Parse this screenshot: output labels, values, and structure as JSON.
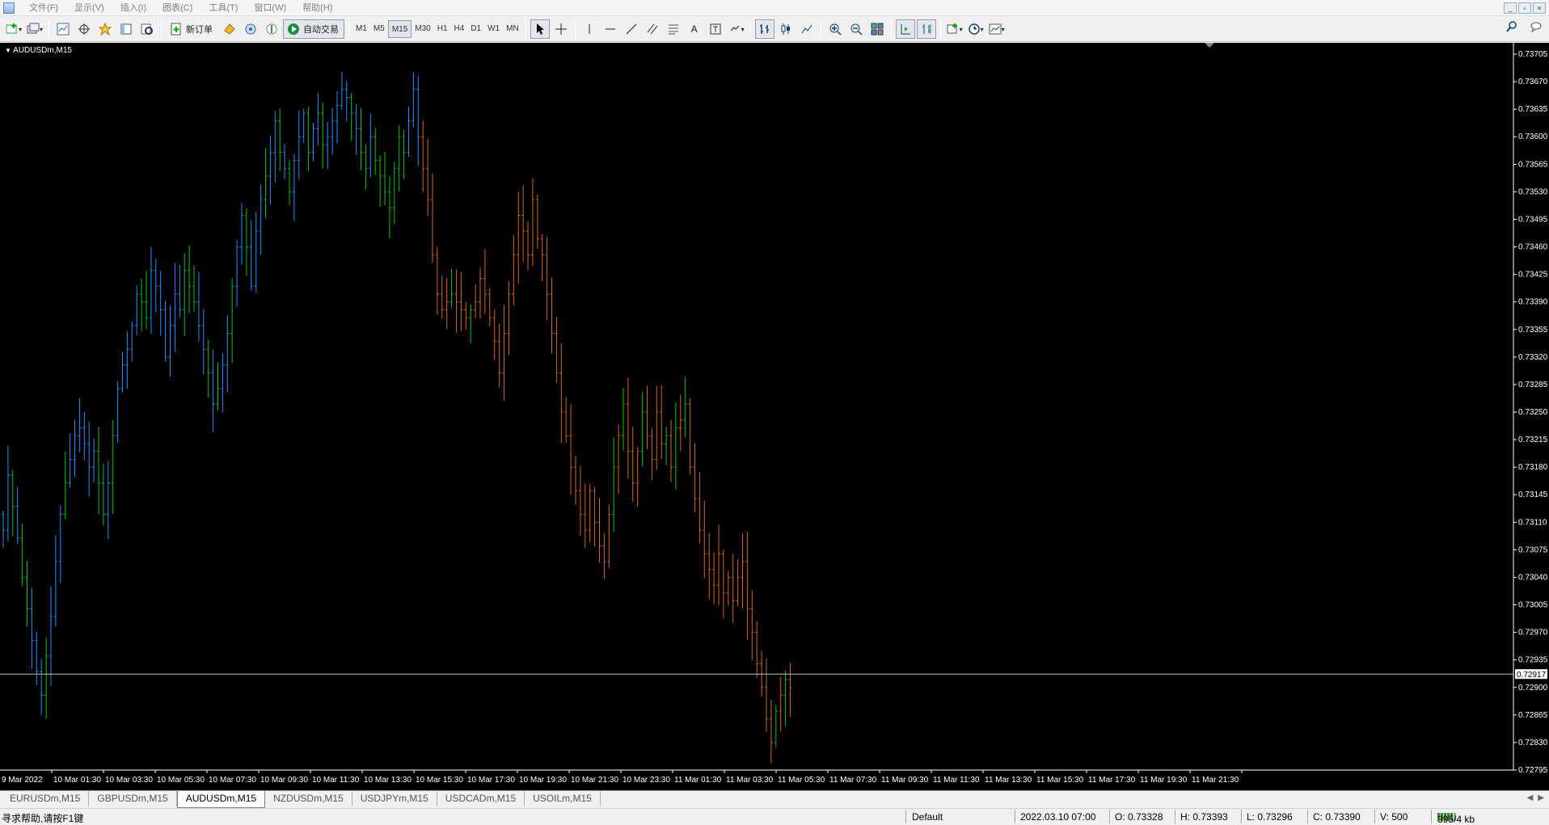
{
  "menu": [
    "文件(F)",
    "显示(V)",
    "插入(I)",
    "图表(C)",
    "工具(T)",
    "窗口(W)",
    "帮助(H)"
  ],
  "toolbar": {
    "new_order": "新订单",
    "auto_trading": "自动交易",
    "timeframes": [
      "M1",
      "M5",
      "M15",
      "M30",
      "H1",
      "H4",
      "D1",
      "W1",
      "MN"
    ],
    "active_timeframe": "M15"
  },
  "chart": {
    "symbol_label": "AUDUSDm,M15",
    "current_price_label": "0.72917",
    "colors": {
      "background": "#000000",
      "up": "#1E90FF",
      "down": "#D2691E",
      "neutral_up": "#00C800",
      "axis": "#ffffff",
      "price_line": "#c0c0c0"
    }
  },
  "chart_data": {
    "type": "ohlc",
    "title": "AUDUSDm,M15",
    "ylim": [
      0.72795,
      0.73705
    ],
    "y_ticks": [
      "0.73705",
      "0.73670",
      "0.73635",
      "0.73600",
      "0.73565",
      "0.73530",
      "0.73495",
      "0.73460",
      "0.73425",
      "0.73390",
      "0.73355",
      "0.73320",
      "0.73285",
      "0.73250",
      "0.73215",
      "0.73180",
      "0.73145",
      "0.73110",
      "0.73075",
      "0.73040",
      "0.73005",
      "0.72970",
      "0.72935",
      "0.72900",
      "0.72865",
      "0.72830",
      "0.72795"
    ],
    "x_ticks": [
      "9 Mar 2022",
      "10 Mar 01:30",
      "10 Mar 03:30",
      "10 Mar 05:30",
      "10 Mar 07:30",
      "10 Mar 09:30",
      "10 Mar 11:30",
      "10 Mar 13:30",
      "10 Mar 15:30",
      "10 Mar 17:30",
      "10 Mar 19:30",
      "10 Mar 21:30",
      "10 Mar 23:30",
      "11 Mar 01:30",
      "11 Mar 03:30",
      "11 Mar 05:30",
      "11 Mar 07:30",
      "11 Mar 09:30",
      "11 Mar 11:30",
      "11 Mar 13:30",
      "11 Mar 15:30",
      "11 Mar 17:30",
      "11 Mar 19:30",
      "11 Mar 21:30"
    ],
    "current_price": 0.72917,
    "closes": [
      0.731,
      0.7317,
      0.7313,
      0.7309,
      0.7304,
      0.73,
      0.7296,
      0.7292,
      0.7289,
      0.7294,
      0.7299,
      0.7306,
      0.7312,
      0.7316,
      0.7319,
      0.7322,
      0.7323,
      0.7321,
      0.7318,
      0.732,
      0.7316,
      0.7312,
      0.7316,
      0.7322,
      0.7328,
      0.7331,
      0.7333,
      0.7336,
      0.734,
      0.7339,
      0.7337,
      0.7343,
      0.7341,
      0.7338,
      0.7332,
      0.7336,
      0.734,
      0.7338,
      0.7343,
      0.7341,
      0.7339,
      0.7336,
      0.7333,
      0.733,
      0.7326,
      0.7328,
      0.7331,
      0.7335,
      0.7341,
      0.7346,
      0.735,
      0.7346,
      0.7341,
      0.7348,
      0.7352,
      0.7355,
      0.7358,
      0.7362,
      0.7358,
      0.7356,
      0.7353,
      0.7357,
      0.736,
      0.7363,
      0.7358,
      0.7361,
      0.7363,
      0.7359,
      0.736,
      0.7362,
      0.7364,
      0.7366,
      0.7365,
      0.7363,
      0.7361,
      0.7358,
      0.7356,
      0.736,
      0.7357,
      0.7355,
      0.7353,
      0.7351,
      0.7356,
      0.736,
      0.7358,
      0.7362,
      0.7366,
      0.736,
      0.7356,
      0.7352,
      0.7345,
      0.734,
      0.7338,
      0.7339,
      0.734,
      0.7339,
      0.7338,
      0.7337,
      0.7338,
      0.7339,
      0.7342,
      0.734,
      0.7337,
      0.7334,
      0.733,
      0.7335,
      0.734,
      0.7345,
      0.735,
      0.7348,
      0.7345,
      0.7352,
      0.7347,
      0.7345,
      0.734,
      0.7335,
      0.733,
      0.7325,
      0.7322,
      0.7318,
      0.7315,
      0.7312,
      0.731,
      0.7315,
      0.7311,
      0.7308,
      0.7306,
      0.7312,
      0.7318,
      0.7322,
      0.7326,
      0.732,
      0.7316,
      0.732,
      0.7325,
      0.7322,
      0.7319,
      0.7325,
      0.7321,
      0.7322,
      0.7318,
      0.7323,
      0.7324,
      0.7326,
      0.7318,
      0.7314,
      0.731,
      0.7307,
      0.7305,
      0.7303,
      0.7307,
      0.7302,
      0.7304,
      0.7301,
      0.7304,
      0.7306,
      0.73,
      0.7297,
      0.7293,
      0.729,
      0.7286,
      0.7283,
      0.7287,
      0.7289,
      0.7291,
      0.729
    ]
  },
  "tabs": [
    "EURUSDm,M15",
    "GBPUSDm,M15",
    "AUDUSDm,M15",
    "NZDUSDm,M15",
    "USDJPYm,M15",
    "USDCADm,M15",
    "USOILm,M15"
  ],
  "active_tab": "AUDUSDm,M15",
  "status": {
    "help": "寻求帮助,请按F1键",
    "profile": "Default",
    "time": "2022.03.10 07:00",
    "open": "O: 0.73328",
    "high": "H: 0.73393",
    "low": "L: 0.73296",
    "close": "C: 0.73390",
    "volume": "V: 500",
    "traffic": "395/4 kb"
  }
}
